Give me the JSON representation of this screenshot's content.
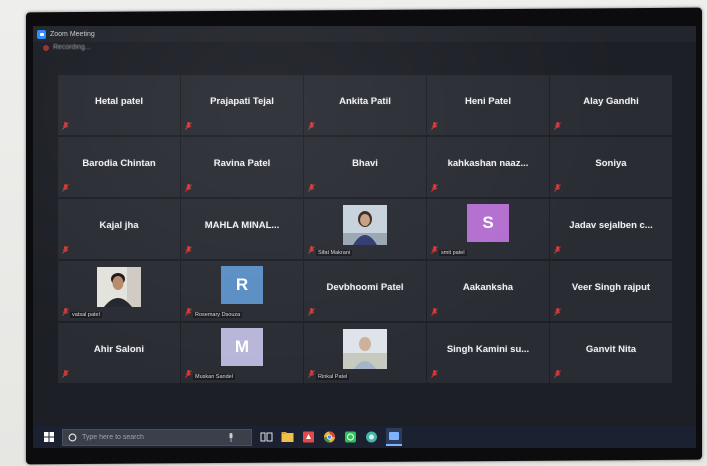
{
  "window": {
    "title": "Zoom Meeting"
  },
  "status": {
    "text": "Recording..."
  },
  "colors": {
    "zoom_blue": "#2d8cff",
    "tile_bg": "#2a2c34",
    "muted_red": "#e03a3a",
    "avatar_r": "#5a8fc4",
    "avatar_s": "#b36fcf",
    "avatar_m": "#b7b5d9"
  },
  "participants": [
    {
      "name": "Hetal patel",
      "type": "name"
    },
    {
      "name": "Prajapati Tejal",
      "type": "name"
    },
    {
      "name": "Ankita Patil",
      "type": "name"
    },
    {
      "name": "Heni Patel",
      "type": "name"
    },
    {
      "name": "Alay Gandhi",
      "type": "name"
    },
    {
      "name": "Barodia Chintan",
      "type": "name"
    },
    {
      "name": "Ravina Patel",
      "type": "name"
    },
    {
      "name": "Bhavi",
      "type": "name"
    },
    {
      "name": "kahkashan  naaz...",
      "type": "name"
    },
    {
      "name": "Soniya",
      "type": "name"
    },
    {
      "name": "Kajal jha",
      "type": "name"
    },
    {
      "name": "MAHLA  MINAL...",
      "type": "name"
    },
    {
      "name": "Sifat Makrani",
      "type": "video",
      "photo": "woman-portrait"
    },
    {
      "name": "smit patel",
      "type": "avatar",
      "letter": "S",
      "color": "#b36fcf"
    },
    {
      "name": "Jadav  sejalben  c...",
      "type": "name"
    },
    {
      "name": "vatsal patel",
      "type": "video",
      "photo": "man-portrait"
    },
    {
      "name": "Rosemary Dsouza",
      "type": "avatar",
      "letter": "R",
      "color": "#5a8fc4"
    },
    {
      "name": "Devbhoomi Patel",
      "type": "name"
    },
    {
      "name": "Aakanksha",
      "type": "name"
    },
    {
      "name": "Veer Singh rajput",
      "type": "name"
    },
    {
      "name": "Ahir Saloni",
      "type": "name"
    },
    {
      "name": "Muskan Sandel",
      "type": "avatar",
      "letter": "M",
      "color": "#b7b5d9"
    },
    {
      "name": "Rinkal Patel",
      "type": "video",
      "photo": "outdoor-portrait"
    },
    {
      "name": "Singh  Kamini  su...",
      "type": "name"
    },
    {
      "name": "Ganvit Nita",
      "type": "name"
    }
  ],
  "taskbar": {
    "search_placeholder": "Type here to search",
    "icons": [
      "start-icon",
      "task-view-icon",
      "file-explorer-icon",
      "pdf-icon",
      "chrome-icon",
      "whatsapp-icon",
      "browser-icon",
      "zoom-icon"
    ]
  }
}
